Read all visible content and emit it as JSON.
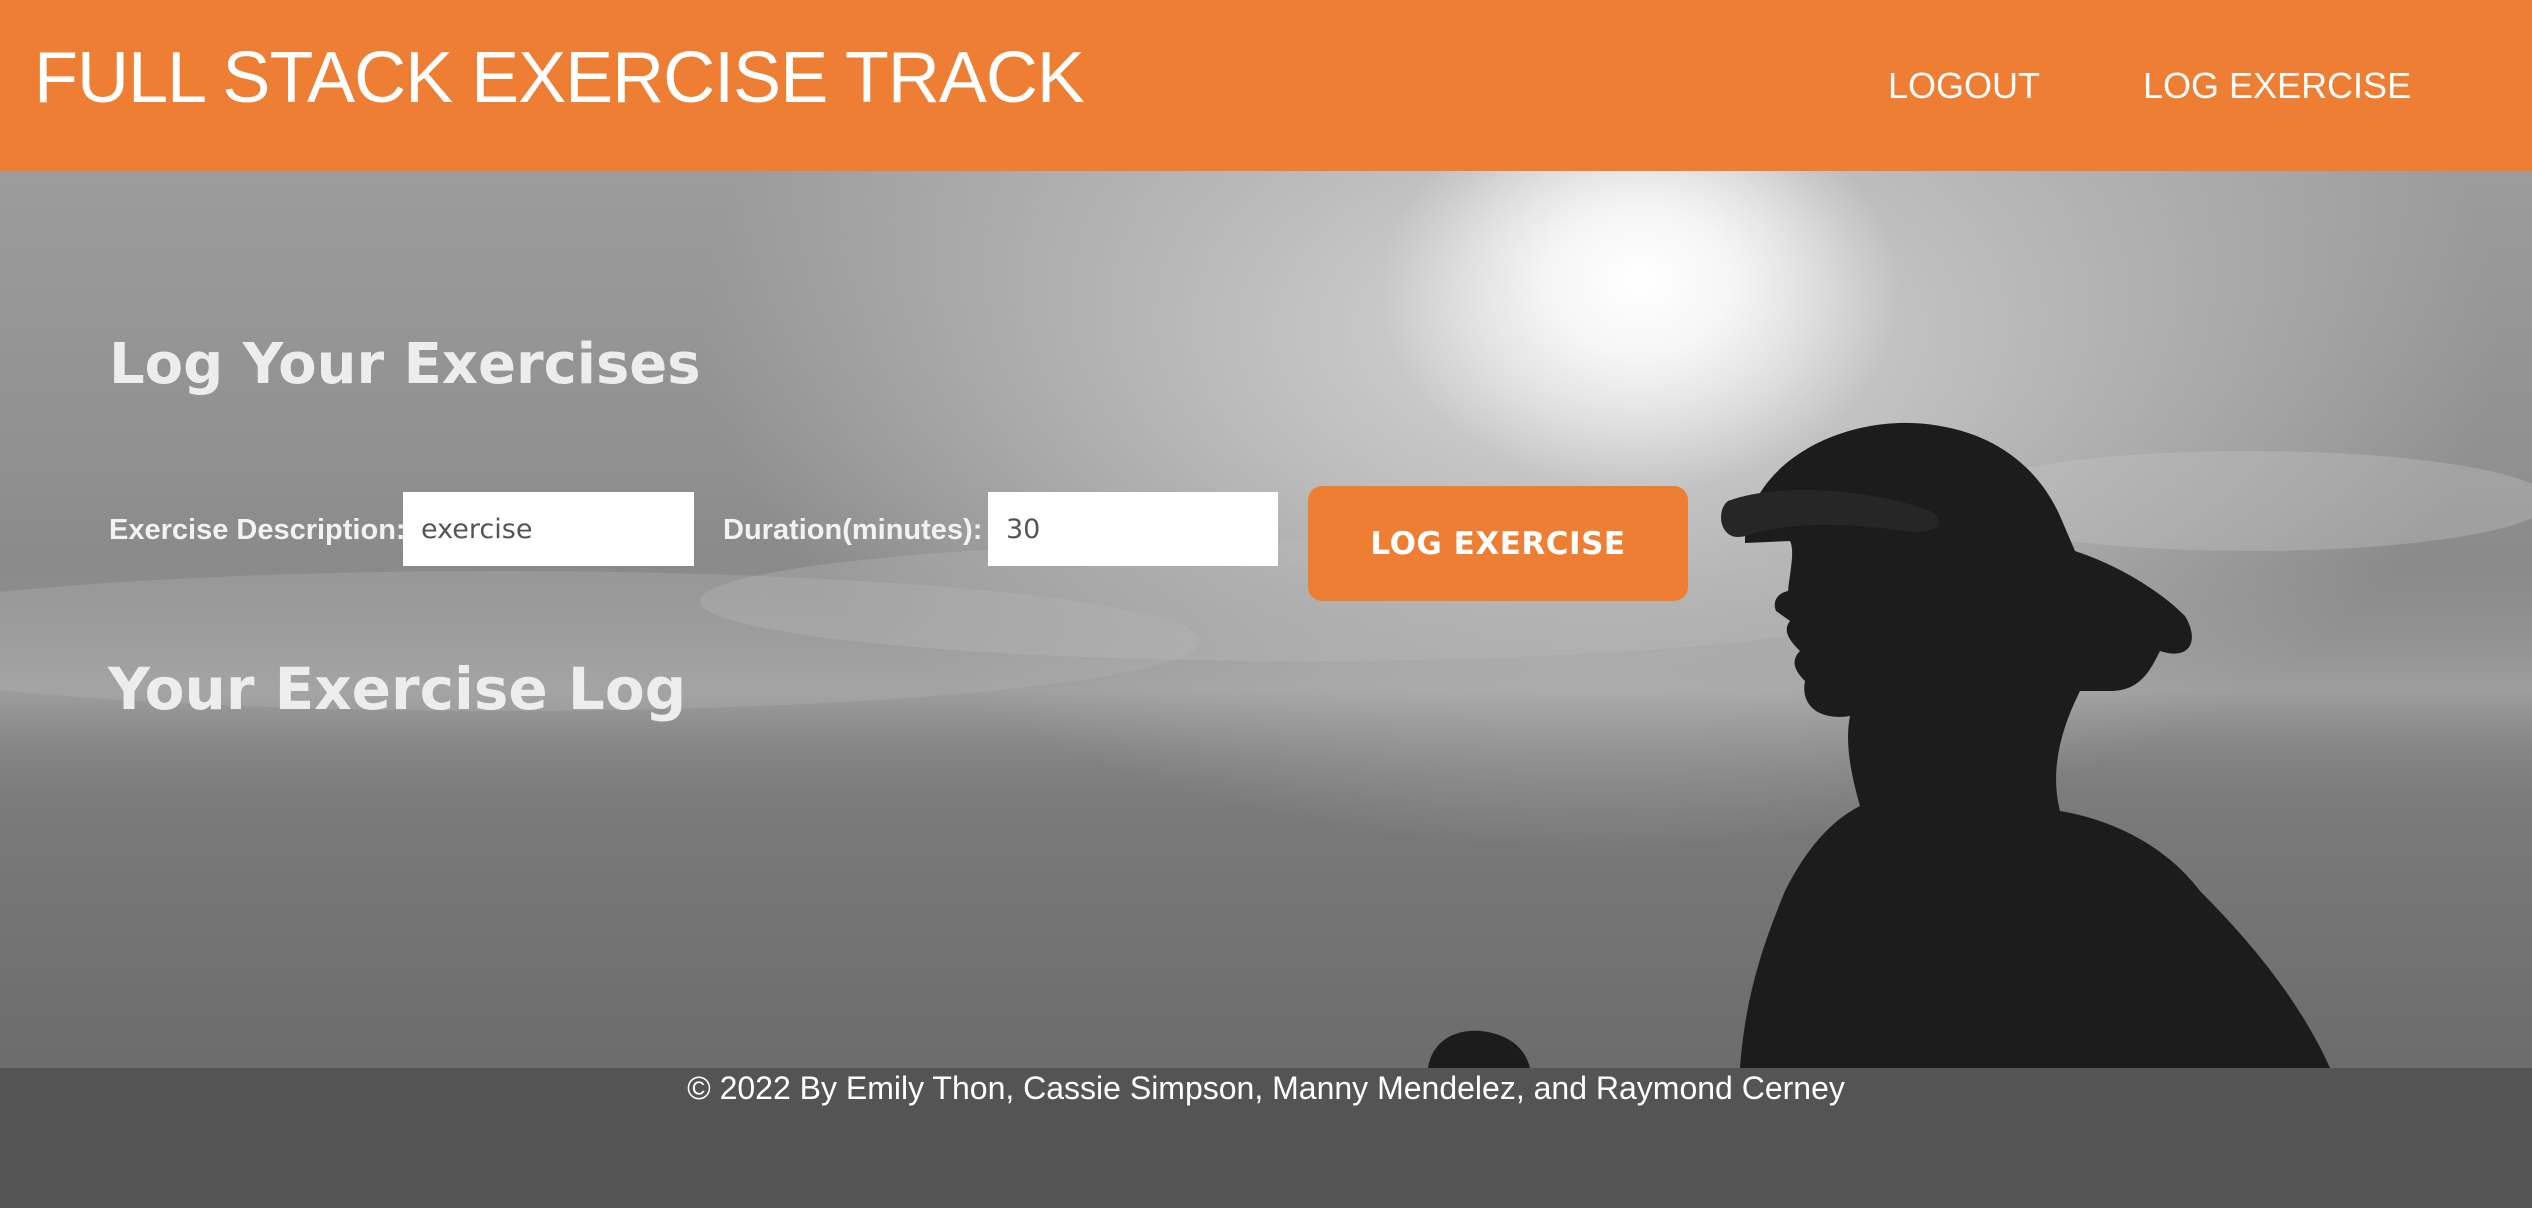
{
  "header": {
    "brand": "FULL STACK EXERCISE TRACK",
    "nav": {
      "logout": "LOGOUT",
      "log_exercise": "LOG EXERCISE"
    }
  },
  "hero": {
    "image_icon": "runner-silhouette-photo"
  },
  "form": {
    "title": "Log Your Exercises",
    "description_label": "Exercise Description:",
    "description_value": "exercise",
    "duration_label": "Duration(minutes):",
    "duration_value": "30",
    "submit_label": "LOG EXERCISE"
  },
  "history": {
    "title": "Your Exercise Log"
  },
  "footer": {
    "text": "© 2022 By Emily Thon, Cassie Simpson, Manny Mendelez, and Raymond Cerney"
  },
  "colors": {
    "accent": "#EE7E33",
    "footer_bg": "#545454",
    "heading_text": "#EDEDED"
  }
}
